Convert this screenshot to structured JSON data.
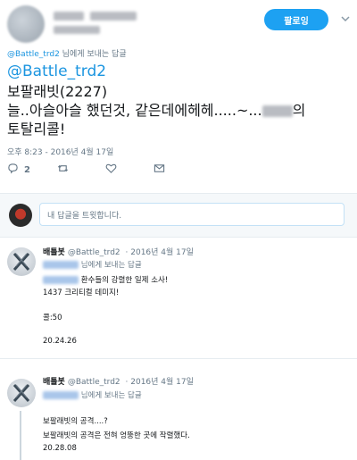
{
  "main_tweet": {
    "follow_label": "팔로잉",
    "caret_icon": "chevron-down-icon",
    "reply_to_handle": "@Battle_trd2",
    "reply_to_suffix": " 님에게 보내는 답글",
    "mention": "@Battle_trd2",
    "text_line1": "보팔래빗(2227)",
    "text_line2_a": "늘..아슬아슬 했던것, 같은데에헤헤.....~...",
    "text_line2_b": "의",
    "text_line3": "토탈리콜!",
    "timestamp": "오후 8:23 - 2016년 4월 17일",
    "reply_count": "2"
  },
  "composer": {
    "placeholder": "내 답글을 트윗합니다."
  },
  "replies": [
    {
      "name": "배틀봇",
      "handle": "@Battle_trd2",
      "date": "· 2016년 4월 17일",
      "reply_to_suffix": "님에게 보내는 답글",
      "line1": "환수들의 강렬한 일제 소사!",
      "line2": "1437 크리티컬 데미지!",
      "line3": "콜:50",
      "line4": "20.24.26"
    },
    {
      "name": "배틀봇",
      "handle": "@Battle_trd2",
      "date": "· 2016년 4월 17일",
      "reply_to_suffix": "님에게 보내는 답글",
      "line1": "보팔래빗의 공격....?",
      "line2": "보팔래빗의 공격은 전혀 엉뚱한 곳에 작렬했다.",
      "line3": "20.28.08"
    }
  ],
  "colors": {
    "accent": "#1da1f2",
    "link": "#1b95e0",
    "muted": "#657786",
    "border": "#e6ecf0"
  },
  "icons": [
    "reply-icon",
    "retweet-icon",
    "like-icon",
    "message-icon",
    "chevron-down-icon"
  ]
}
